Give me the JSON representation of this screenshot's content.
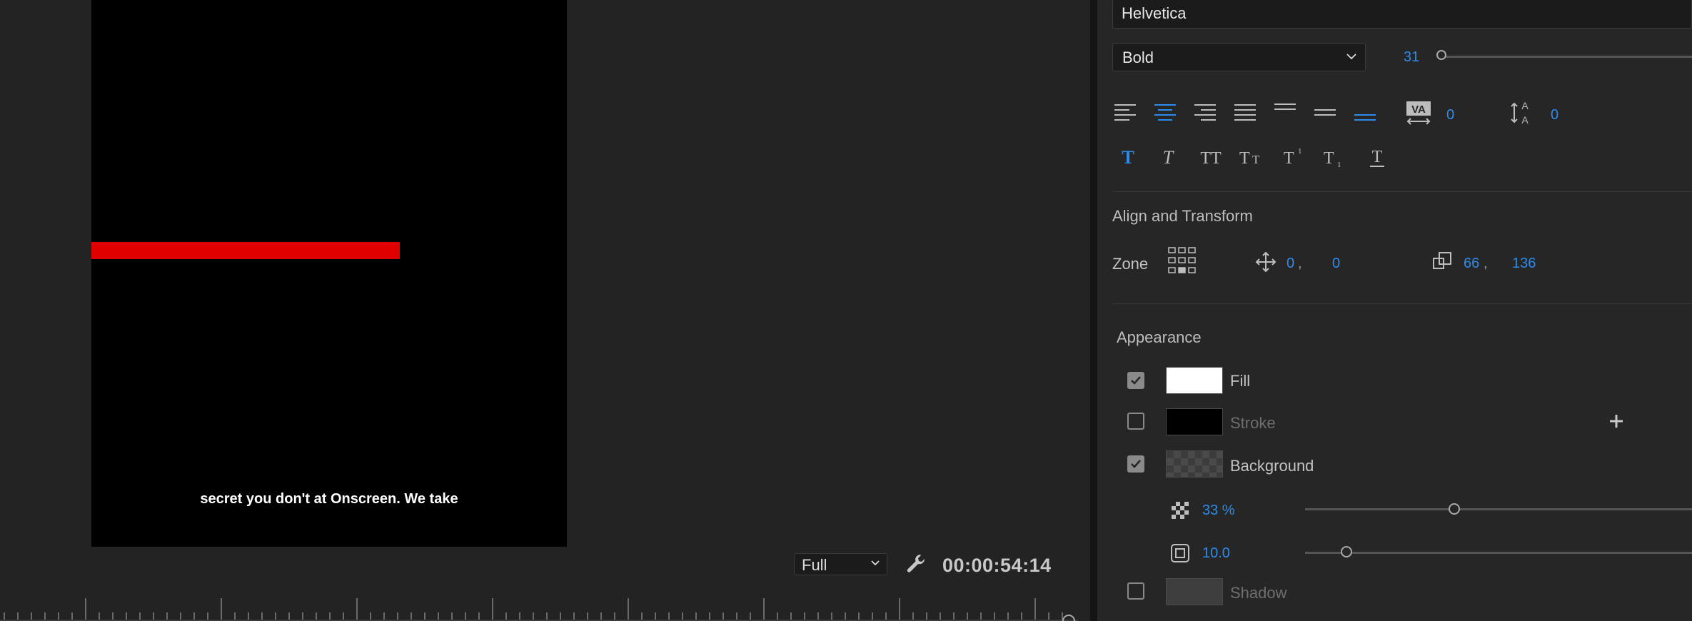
{
  "monitor": {
    "caption": "secret you don't at Onscreen. We take",
    "quality": "Full",
    "timecode": "00:00:54:14"
  },
  "text": {
    "font_family": "Helvetica",
    "font_style": "Bold",
    "font_size": "31",
    "kerning": "0",
    "leading": "0",
    "active_alignment": "center"
  },
  "align_transform": {
    "title": "Align and Transform",
    "zone_label": "Zone",
    "position_x": "0",
    "position_y": "0",
    "position_sep": ",",
    "scale_w": "66",
    "scale_h": "136",
    "scale_sep": ","
  },
  "appearance": {
    "title": "Appearance",
    "fill": {
      "label": "Fill",
      "checked": true,
      "color": "#ffffff"
    },
    "stroke": {
      "label": "Stroke",
      "checked": false,
      "color": "#000000"
    },
    "background": {
      "label": "Background",
      "checked": true,
      "opacity": "33 %",
      "opacity_fraction": 0.33,
      "corner": "10.0",
      "corner_fraction": 0.1
    },
    "shadow": {
      "label": "Shadow",
      "checked": false
    }
  },
  "colors": {
    "accent": "#2d8ceb",
    "video_red_bar": "#e00000"
  }
}
